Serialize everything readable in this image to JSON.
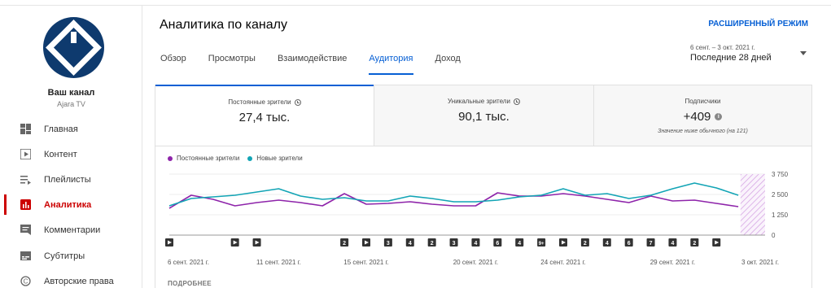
{
  "sidebar": {
    "channel_name": "Ваш канал",
    "channel_handle": "Ajara TV",
    "items": [
      {
        "label": "Главная",
        "icon": "dashboard-icon"
      },
      {
        "label": "Контент",
        "icon": "content-icon"
      },
      {
        "label": "Плейлисты",
        "icon": "playlist-icon"
      },
      {
        "label": "Аналитика",
        "icon": "analytics-icon",
        "active": true
      },
      {
        "label": "Комментарии",
        "icon": "comments-icon"
      },
      {
        "label": "Субтитры",
        "icon": "subtitles-icon"
      },
      {
        "label": "Авторские права",
        "icon": "copyright-icon"
      }
    ]
  },
  "header": {
    "title": "Аналитика по каналу",
    "advanced_mode": "РАСШИРЕННЫЙ РЕЖИМ",
    "date_range": "6 сент. – 3 окт. 2021 г.",
    "date_period": "Последние 28 дней",
    "tabs": [
      "Обзор",
      "Просмотры",
      "Взаимодействие",
      "Аудитория",
      "Доход"
    ],
    "active_tab": "Аудитория"
  },
  "metrics": [
    {
      "label": "Постоянные зрители",
      "value": "27,4 тыс."
    },
    {
      "label": "Уникальные зрители",
      "value": "90,1 тыс."
    },
    {
      "label": "Подписчики",
      "value": "+409",
      "note": "Значение ниже обычного (на 121)"
    }
  ],
  "details_label": "ПОДРОБНЕЕ",
  "colors": {
    "accent": "#065fd4",
    "active_nav": "#cc0000",
    "series_returning": "#8e24aa",
    "series_new": "#12a4b5"
  },
  "chart_data": {
    "type": "line",
    "x": [
      "6 сент. 2021 г.",
      "7",
      "8",
      "9",
      "10",
      "11 сент. 2021 г.",
      "12",
      "13",
      "14",
      "15 сент. 2021 г.",
      "16",
      "17",
      "18",
      "19",
      "20 сент. 2021 г.",
      "21",
      "22",
      "23",
      "24 сент. 2021 г.",
      "25",
      "26",
      "27",
      "28",
      "29 сент. 2021 г.",
      "30",
      "1",
      "2",
      "3 окт. 2021 г."
    ],
    "x_tick_labels": [
      "6 сент. 2021 г.",
      "11 сент. 2021 г.",
      "15 сент. 2021 г.",
      "20 сент. 2021 г.",
      "24 сент. 2021 г.",
      "29 сент. 2021 г.",
      "3 окт. 2021 г."
    ],
    "x_tick_indices": [
      0,
      5,
      9,
      14,
      18,
      23,
      27
    ],
    "ylim": [
      0,
      3750
    ],
    "y_ticks": [
      "0",
      "1 250",
      "2 500",
      "3 750"
    ],
    "series": [
      {
        "name": "Постоянные зрители",
        "values": [
          1650,
          2450,
          2200,
          1800,
          2000,
          2150,
          2000,
          1800,
          2550,
          1900,
          1950,
          2050,
          1900,
          1800,
          1800,
          2600,
          2400,
          2400,
          2550,
          2400,
          2200,
          2000,
          2400,
          2100,
          2150,
          1950,
          1750
        ]
      },
      {
        "name": "Новые зрители",
        "values": [
          1800,
          2250,
          2350,
          2450,
          2650,
          2850,
          2400,
          2200,
          2300,
          2100,
          2100,
          2400,
          2250,
          2050,
          2050,
          2150,
          2350,
          2450,
          2850,
          2450,
          2550,
          2250,
          2450,
          2850,
          3200,
          2900,
          2450
        ]
      }
    ],
    "markers": [
      {
        "day": 0,
        "label": "▶"
      },
      {
        "day": 3,
        "label": "▶"
      },
      {
        "day": 4,
        "label": "▶"
      },
      {
        "day": 8,
        "label": "2"
      },
      {
        "day": 9,
        "label": "▶"
      },
      {
        "day": 10,
        "label": "3"
      },
      {
        "day": 11,
        "label": "4"
      },
      {
        "day": 12,
        "label": "2"
      },
      {
        "day": 13,
        "label": "3"
      },
      {
        "day": 14,
        "label": "4"
      },
      {
        "day": 15,
        "label": "6"
      },
      {
        "day": 16,
        "label": "4"
      },
      {
        "day": 17,
        "label": "9+"
      },
      {
        "day": 18,
        "label": "▶"
      },
      {
        "day": 19,
        "label": "2"
      },
      {
        "day": 20,
        "label": "4"
      },
      {
        "day": 21,
        "label": "6"
      },
      {
        "day": 22,
        "label": "7"
      },
      {
        "day": 23,
        "label": "4"
      },
      {
        "day": 24,
        "label": "2"
      },
      {
        "day": 25,
        "label": "▶"
      }
    ]
  }
}
